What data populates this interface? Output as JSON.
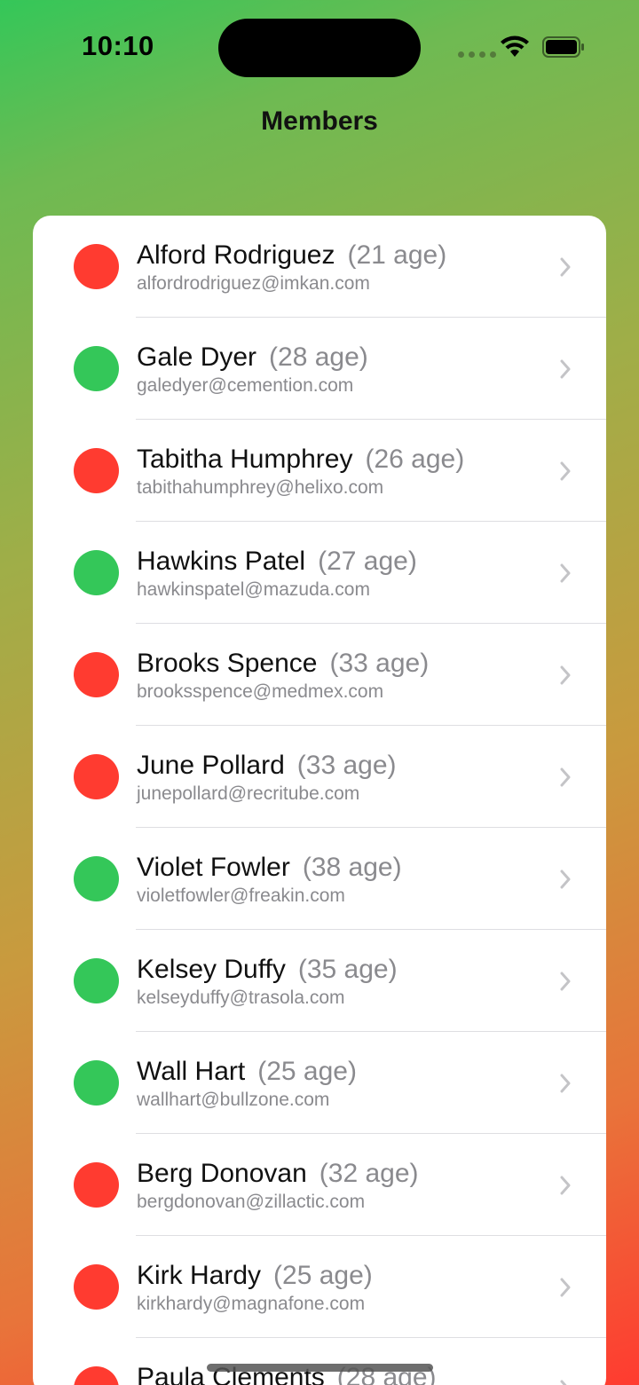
{
  "status_bar": {
    "time": "10:10"
  },
  "nav": {
    "title": "Members"
  },
  "colors": {
    "active": "#34C759",
    "inactive": "#FF3B30"
  },
  "members": [
    {
      "name": "Alford Rodriguez",
      "age": "(21 age)",
      "email": "alfordrodriguez@imkan.com",
      "status": "inactive"
    },
    {
      "name": "Gale Dyer",
      "age": "(28 age)",
      "email": "galedyer@cemention.com",
      "status": "active"
    },
    {
      "name": "Tabitha Humphrey",
      "age": "(26 age)",
      "email": "tabithahumphrey@helixo.com",
      "status": "inactive"
    },
    {
      "name": "Hawkins Patel",
      "age": "(27 age)",
      "email": "hawkinspatel@mazuda.com",
      "status": "active"
    },
    {
      "name": "Brooks Spence",
      "age": "(33 age)",
      "email": "brooksspence@medmex.com",
      "status": "inactive"
    },
    {
      "name": "June Pollard",
      "age": "(33 age)",
      "email": "junepollard@recritube.com",
      "status": "inactive"
    },
    {
      "name": "Violet Fowler",
      "age": "(38 age)",
      "email": "violetfowler@freakin.com",
      "status": "active"
    },
    {
      "name": "Kelsey Duffy",
      "age": "(35 age)",
      "email": "kelseyduffy@trasola.com",
      "status": "active"
    },
    {
      "name": "Wall Hart",
      "age": "(25 age)",
      "email": "wallhart@bullzone.com",
      "status": "active"
    },
    {
      "name": "Berg Donovan",
      "age": "(32 age)",
      "email": "bergdonovan@zillactic.com",
      "status": "inactive"
    },
    {
      "name": "Kirk Hardy",
      "age": "(25 age)",
      "email": "kirkhardy@magnafone.com",
      "status": "inactive"
    },
    {
      "name": "Paula Clements",
      "age": "(28 age)",
      "email": "",
      "status": "inactive"
    }
  ]
}
